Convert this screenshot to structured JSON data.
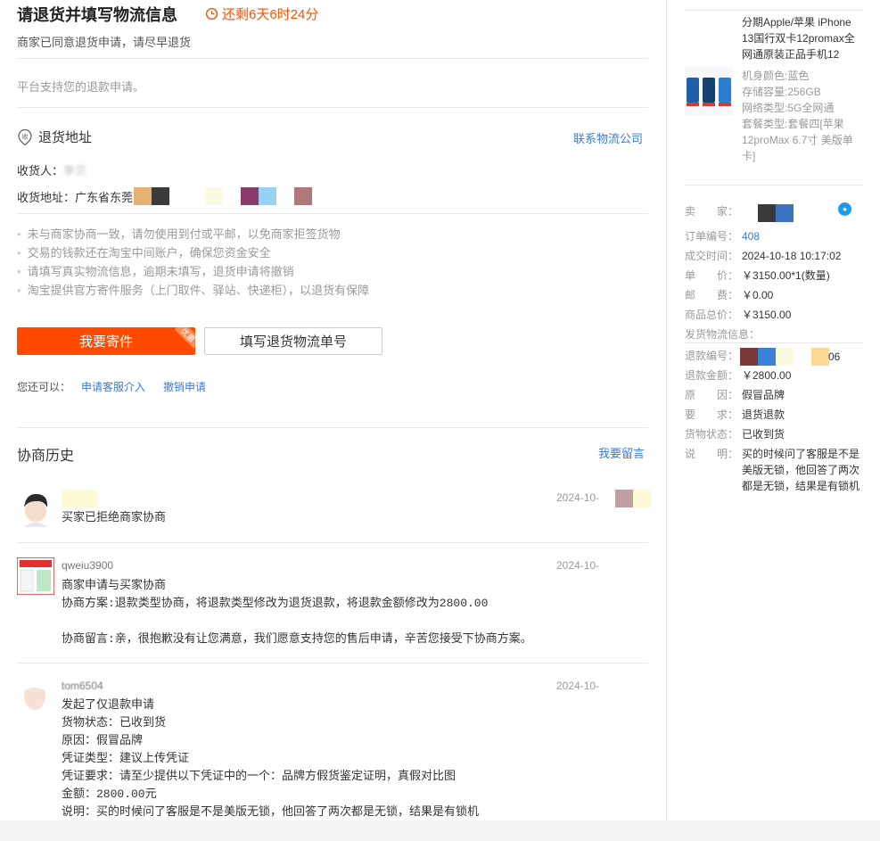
{
  "header": {
    "title": "请退货并填写物流信息",
    "timer": "还剩6天6时24分",
    "subtitle": "商家已同意退货申请，请尽早退货",
    "platform_note": "平台支持您的退款申请。"
  },
  "address": {
    "heading": "退货地址",
    "contact_link": "联系物流公司",
    "receiver_label": "收货人：",
    "receiver_value": "李贝",
    "address_label": "收货地址：",
    "address_value": "广东省东莞"
  },
  "tips": [
    "未与商家协商一致，请勿使用到付或平邮，以免商家拒签货物",
    "交易的钱款还在淘宝中间账户，确保您资金安全",
    "请填写真实物流信息，逾期未填写，退货申请将撤销",
    "淘宝提供官方寄件服务（上门取件、驿站、快递柜），以退货有保障"
  ],
  "actions": {
    "primary": "我要寄件",
    "primary_tag": "优惠",
    "secondary": "填写退货物流单号",
    "also_label": "您还可以：",
    "link_service": "申请客服介入",
    "link_cancel": "撤销申请"
  },
  "history": {
    "title": "协商历史",
    "leave_message": "我要留言",
    "entries": [
      {
        "user": "",
        "time": "2024-10-",
        "text": "买家已拒绝商家协商"
      },
      {
        "user": "qweiu3900",
        "time": "2024-10-",
        "text": "商家申请与买家协商\n协商方案:退款类型协商，将退款类型修改为退货退款，将退款金额修改为2800.00\n\n协商留言:亲，很抱歉没有让您满意，我们愿意支持您的售后申请，辛苦您接受下协商方案。"
      },
      {
        "user": "tom6504",
        "time": "2024-10-",
        "text": "发起了仅退款申请\n货物状态：已收到货\n原因：假冒品牌\n凭证类型：建议上传凭证\n凭证要求：请至少提供以下凭证中的一个：品牌方假货鉴定证明，真假对比图\n金额：2800.00元\n说明：买的时候问了客服是不是美版无锁，他回答了两次都是无锁，结果是有锁机"
      }
    ]
  },
  "product": {
    "name": "分期Apple/苹果 iPhone 13国行双卡12promax全网通原装正品手机12",
    "specs": [
      "机身颜色:蓝色",
      "存储容量:256GB",
      "网络类型:5G全网通",
      "套餐类型:套餐四[苹果12proMax 6.7寸 美版单卡]"
    ]
  },
  "order": {
    "seller": {
      "k": "卖　　家：",
      "v": ""
    },
    "order_no": {
      "k": "订单编号：",
      "v": "408"
    },
    "deal_time": {
      "k": "成交时间：",
      "v": "2024-10-18 10:17:02"
    },
    "unit_price": {
      "k": "单　　价：",
      "v": "￥3150.00*1(数量)"
    },
    "shipping": {
      "k": "邮　　费：",
      "v": "￥0.00"
    },
    "total": {
      "k": "商品总价：",
      "v": "￥3150.00"
    },
    "ship_info": {
      "k": "发货物流信息：",
      "v": ""
    }
  },
  "refund": {
    "no": {
      "k": "退款编号：",
      "v": "06"
    },
    "amount": {
      "k": "退款金额：",
      "v": "￥2800.00"
    },
    "reason": {
      "k": "原　　因：",
      "v": "假冒品牌"
    },
    "request": {
      "k": "要　　求：",
      "v": "退货退款"
    },
    "goods_status": {
      "k": "货物状态：",
      "v": "已收到货"
    },
    "note": {
      "k": "说　　明：",
      "v": "买的时候问了客服是不是美版无锁，他回答了两次都是无锁，结果是有锁机"
    }
  },
  "colors": {
    "accent": "#ff4a00",
    "link": "#3a7bd5"
  }
}
